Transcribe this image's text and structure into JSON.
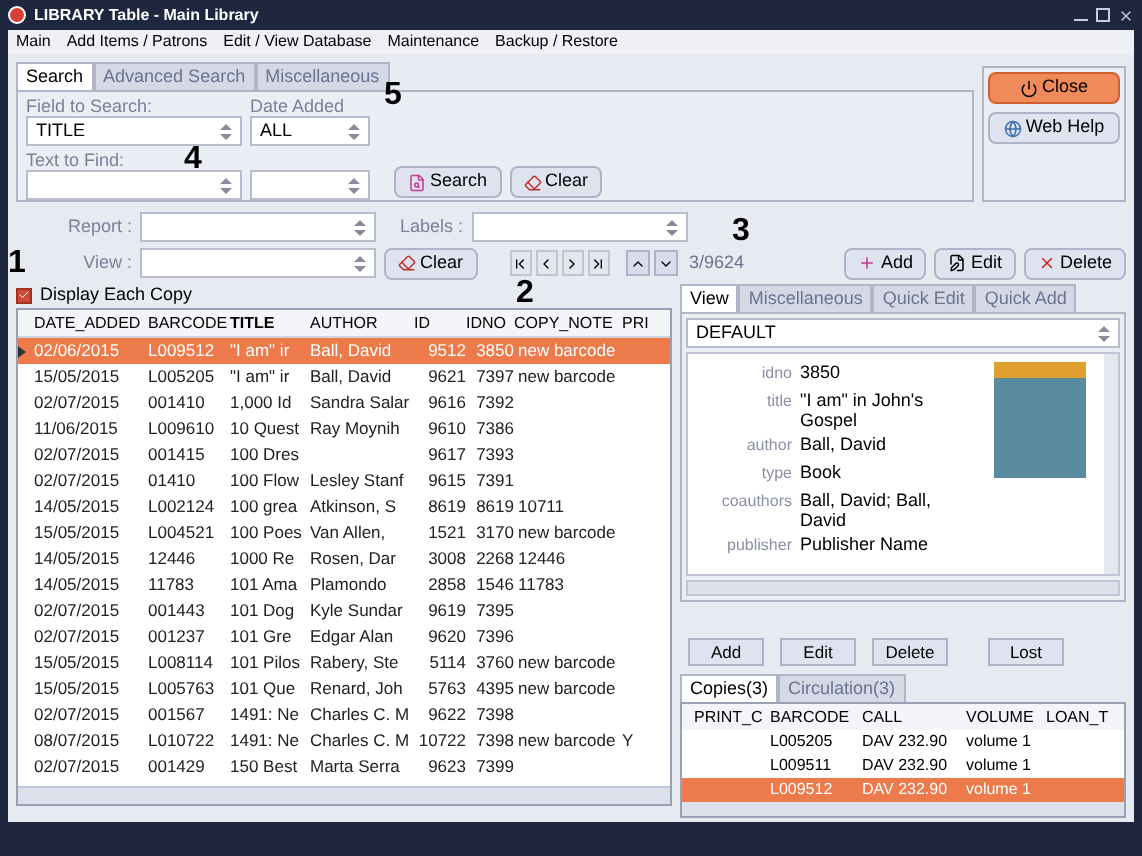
{
  "window": {
    "title": "LIBRARY Table - Main Library"
  },
  "menu": [
    "Main",
    "Add Items / Patrons",
    "Edit / View Database",
    "Maintenance",
    "Backup / Restore"
  ],
  "search_tabs": [
    {
      "label": "Search",
      "selected": true
    },
    {
      "label": "Advanced Search",
      "selected": false
    },
    {
      "label": "Miscellaneous",
      "selected": false
    }
  ],
  "search_form": {
    "field_to_search": {
      "label": "Field to Search:",
      "value": "TITLE"
    },
    "date_added": {
      "label": "Date Added",
      "value": "ALL"
    },
    "text_to_find": {
      "label": "Text to Find:"
    },
    "search_button": "Search",
    "clear_button": "Clear"
  },
  "side_buttons": {
    "close": "Close",
    "web_help": "Web Help"
  },
  "report": {
    "label": "Report :"
  },
  "labels": {
    "label": "Labels :"
  },
  "view": {
    "label": "View :",
    "clear_button": "Clear"
  },
  "record_counter": "3/9624",
  "actions": [
    "Add",
    "Edit",
    "Delete"
  ],
  "display_each_copy": {
    "label": "Display Each Copy",
    "checked": true
  },
  "table": {
    "columns": [
      "DATE_ADDED",
      "BARCODE",
      "TITLE",
      "AUTHOR",
      "ID",
      "IDNO",
      "COPY_NOTE",
      "PRI"
    ],
    "rows": [
      {
        "selected": true,
        "cells": [
          "02/06/2015",
          "L009512",
          "\"I am\" ir",
          "Ball, David",
          "9512",
          "3850",
          "new barcode",
          ""
        ]
      },
      {
        "selected": false,
        "cells": [
          "15/05/2015",
          "L005205",
          "\"I am\" ir",
          "Ball, David",
          "9621",
          "7397",
          "new barcode",
          ""
        ]
      },
      {
        "selected": false,
        "cells": [
          "02/07/2015",
          "001410",
          "1,000 Id",
          "Sandra Salar",
          "9616",
          "7392",
          "",
          ""
        ]
      },
      {
        "selected": false,
        "cells": [
          "11/06/2015",
          "L009610",
          "10 Quest",
          "Ray Moynih",
          "9610",
          "7386",
          "",
          ""
        ]
      },
      {
        "selected": false,
        "cells": [
          "02/07/2015",
          "001415",
          "100 Dres",
          "",
          "9617",
          "7393",
          "",
          ""
        ]
      },
      {
        "selected": false,
        "cells": [
          "02/07/2015",
          "01410",
          "100 Flow",
          "Lesley Stanf",
          "9615",
          "7391",
          "",
          ""
        ]
      },
      {
        "selected": false,
        "cells": [
          "14/05/2015",
          "L002124",
          "100 grea",
          "Atkinson, S",
          "8619",
          "8619",
          "10711",
          ""
        ]
      },
      {
        "selected": false,
        "cells": [
          "15/05/2015",
          "L004521",
          "100 Poes",
          "Van Allen,",
          "1521",
          "3170",
          "new barcode",
          ""
        ]
      },
      {
        "selected": false,
        "cells": [
          "14/05/2015",
          "12446",
          "1000 Re",
          "Rosen, Dar",
          "3008",
          "2268",
          "12446",
          ""
        ]
      },
      {
        "selected": false,
        "cells": [
          "14/05/2015",
          "11783",
          "101 Ama",
          "Plamondo",
          "2858",
          "1546",
          "11783",
          ""
        ]
      },
      {
        "selected": false,
        "cells": [
          "02/07/2015",
          "001443",
          "101 Dog",
          "Kyle Sundar",
          "9619",
          "7395",
          "",
          ""
        ]
      },
      {
        "selected": false,
        "cells": [
          "02/07/2015",
          "001237",
          "101 Gre",
          "Edgar Alan",
          "9620",
          "7396",
          "",
          ""
        ]
      },
      {
        "selected": false,
        "cells": [
          "15/05/2015",
          "L008114",
          "101 Pilos",
          "Rabery, Ste",
          "5114",
          "3760",
          "new barcode",
          ""
        ]
      },
      {
        "selected": false,
        "cells": [
          "15/05/2015",
          "L005763",
          "101 Que",
          "Renard, Joh",
          "5763",
          "4395",
          "new barcode",
          ""
        ]
      },
      {
        "selected": false,
        "cells": [
          "02/07/2015",
          "001567",
          "1491: Ne",
          "Charles C. M",
          "9622",
          "7398",
          "",
          ""
        ]
      },
      {
        "selected": false,
        "cells": [
          "08/07/2015",
          "L010722",
          "1491: Ne",
          "Charles C. M",
          "10722",
          "7398",
          "new barcode",
          "Y"
        ]
      },
      {
        "selected": false,
        "cells": [
          "02/07/2015",
          "001429",
          "150 Best",
          "Marta Serra",
          "9623",
          "7399",
          "",
          ""
        ]
      }
    ]
  },
  "detail_tabs": [
    {
      "label": "View",
      "selected": true
    },
    {
      "label": "Miscellaneous",
      "selected": false
    },
    {
      "label": "Quick Edit",
      "selected": false
    },
    {
      "label": "Quick Add",
      "selected": false
    }
  ],
  "detail_view": {
    "value": "DEFAULT"
  },
  "details": [
    {
      "label": "idno",
      "value": "3850"
    },
    {
      "label": "title",
      "value": "\"I am\" in John's Gospel"
    },
    {
      "label": "author",
      "value": "Ball, David"
    },
    {
      "label": "type",
      "value": "Book"
    },
    {
      "label": "coauthors",
      "value": "Ball, David; Ball, David"
    },
    {
      "label": "publisher",
      "value": "Publisher Name"
    }
  ],
  "copy_buttons": [
    "Add",
    "Edit",
    "Delete",
    "Lost"
  ],
  "copy_tabs": [
    {
      "label": "Copies(3)",
      "selected": true
    },
    {
      "label": "Circulation(3)",
      "selected": false
    }
  ],
  "copies": {
    "columns": [
      "PRINT_C",
      "BARCODE",
      "CALL",
      "VOLUME",
      "LOAN_T"
    ],
    "rows": [
      {
        "selected": false,
        "cells": [
          "",
          "L005205",
          "DAV 232.90",
          "volume 1",
          ""
        ]
      },
      {
        "selected": false,
        "cells": [
          "",
          "L009511",
          "DAV 232.90",
          "volume 1",
          ""
        ]
      },
      {
        "selected": true,
        "cells": [
          "",
          "L009512",
          "DAV 232.90",
          "volume 1",
          ""
        ]
      }
    ]
  },
  "annotations": [
    "1",
    "2",
    "3",
    "4",
    "5"
  ]
}
